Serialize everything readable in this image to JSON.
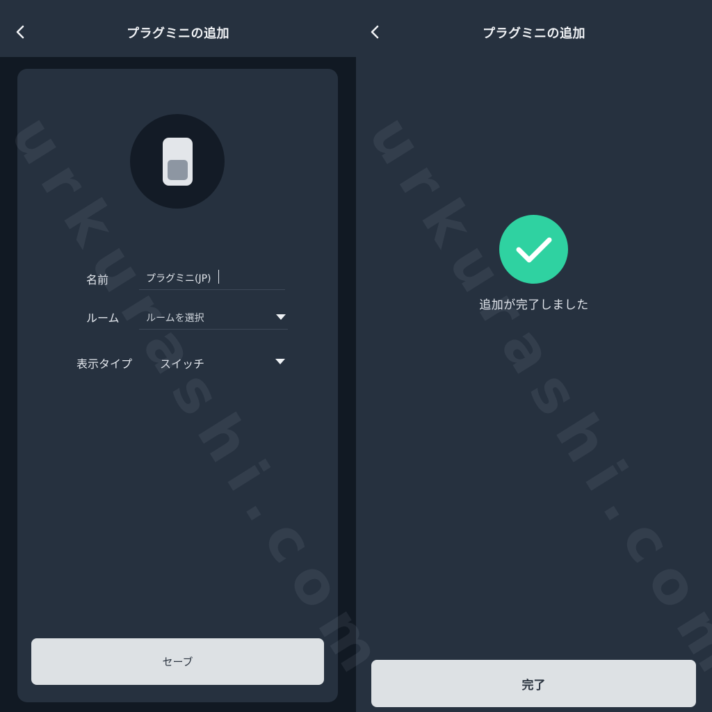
{
  "left_screen": {
    "title": "プラグミニの追加",
    "fields": {
      "name_label": "名前",
      "name_value": "プラグミニ(JP)",
      "room_label": "ルーム",
      "room_placeholder": "ルームを選択",
      "display_type_label": "表示タイプ",
      "display_type_value": "スイッチ"
    },
    "save_label": "セーブ"
  },
  "right_screen": {
    "title": "プラグミニの追加",
    "success_message": "追加が完了しました",
    "done_label": "完了"
  },
  "watermark": "urkurashi.com",
  "icons": {
    "back": "chevron-left-icon",
    "device": "smart-plug-icon",
    "success": "checkmark-icon",
    "dropdown": "caret-down-icon"
  },
  "colors": {
    "background": "#26313f",
    "card": "#26313f",
    "accent_success": "#2fd2a1",
    "button": "#dde1e4"
  }
}
